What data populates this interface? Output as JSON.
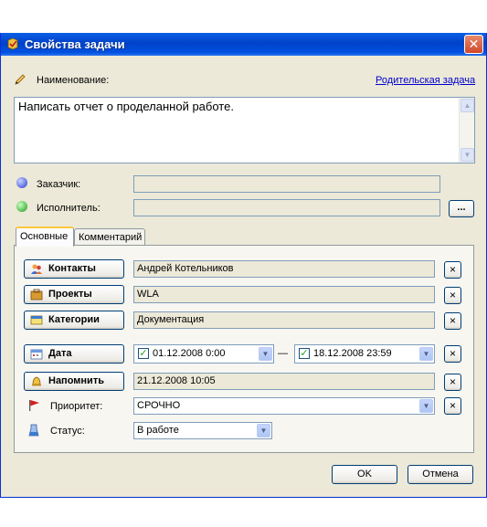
{
  "window": {
    "title": "Свойства задачи",
    "close": "✕"
  },
  "name_label": "Наименование:",
  "parent_task_link": "Родительская задача",
  "task_text": "Написать отчет о проделанной работе.",
  "customer": {
    "label": "Заказчик:",
    "value": ""
  },
  "executor": {
    "label": "Исполнитель:",
    "value": "",
    "browse": "..."
  },
  "tabs": [
    {
      "label": "Основные"
    },
    {
      "label": "Комментарий"
    }
  ],
  "contacts": {
    "button": "Контакты",
    "value": "Андрей Котельников"
  },
  "projects": {
    "button": "Проекты",
    "value": "WLA"
  },
  "categories": {
    "button": "Категории",
    "value": "Документация"
  },
  "date": {
    "button": "Дата",
    "from": "01.12.2008  0:00",
    "to": "18.12.2008 23:59",
    "separator": "—"
  },
  "remind": {
    "button": "Напомнить",
    "value": "21.12.2008 10:05"
  },
  "priority": {
    "label": "Приоритет:",
    "value": "СРОЧНО"
  },
  "status": {
    "label": "Статус:",
    "value": "В работе"
  },
  "clear": "×",
  "footer": {
    "ok": "OK",
    "cancel": "Отмена"
  },
  "colors": {
    "titlebar": "#0054e3",
    "window_bg": "#ece9d8",
    "link": "#0000cc"
  }
}
